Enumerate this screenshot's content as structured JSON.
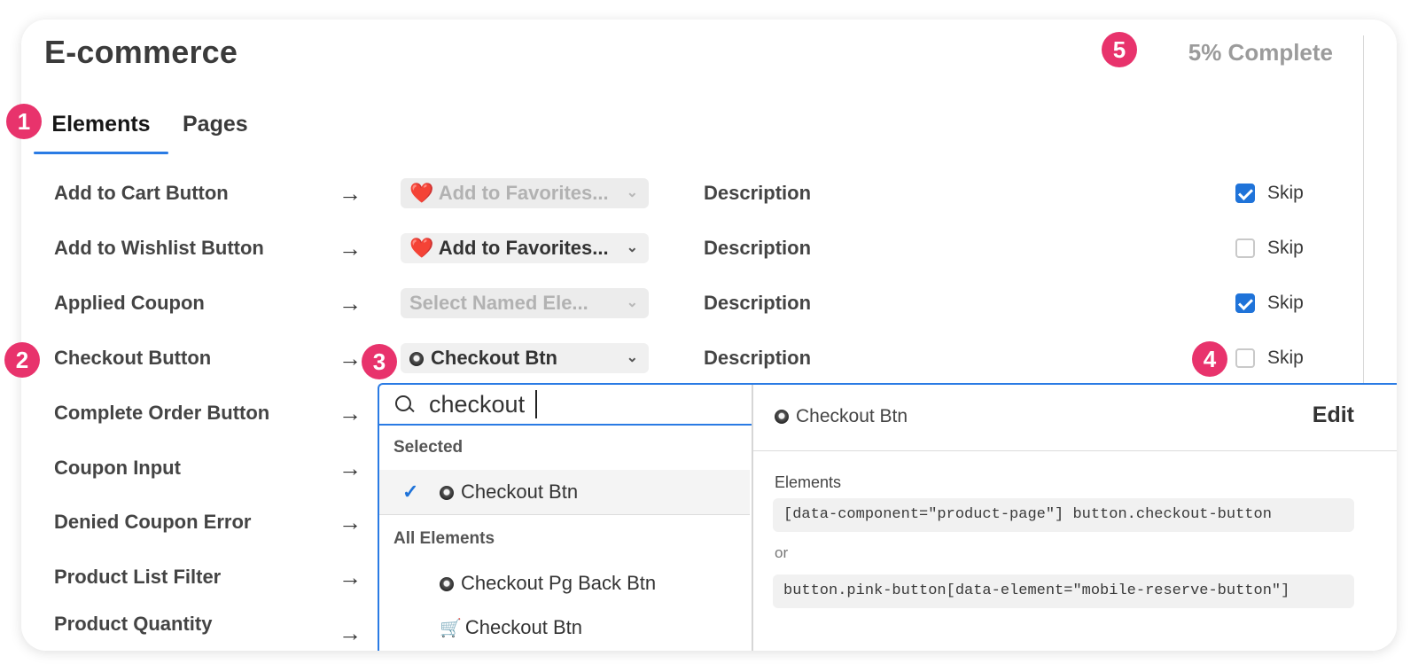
{
  "header": {
    "title": "E-commerce",
    "progress": "5% Complete"
  },
  "tabs": [
    {
      "label": "Elements"
    },
    {
      "label": "Pages"
    }
  ],
  "annotations": [
    "1",
    "2",
    "3",
    "4",
    "5"
  ],
  "rows": [
    {
      "label": "Add to Cart Button",
      "arrow": "→",
      "select": "❤️ Add to Favorites...",
      "select_state": "disabled",
      "description": "Description",
      "skip": "Skip",
      "skip_checked": true
    },
    {
      "label": "Add to Wishlist Button",
      "arrow": "→",
      "select": "❤️ Add to Favorites...",
      "select_state": "enabled",
      "description": "Description",
      "skip": "Skip",
      "skip_checked": false
    },
    {
      "label": "Applied Coupon",
      "arrow": "→",
      "select": "Select Named Ele...",
      "select_state": "disabled",
      "description": "Description",
      "skip": "Skip",
      "skip_checked": true
    },
    {
      "label": "Checkout Button",
      "arrow": "→",
      "select": "Checkout Btn",
      "select_state": "enabled",
      "description": "Description",
      "skip": "Skip",
      "skip_checked": false
    },
    {
      "label": "Complete Order Button",
      "arrow": "→"
    },
    {
      "label": "Coupon Input",
      "arrow": "→"
    },
    {
      "label": "Denied Coupon Error",
      "arrow": "→"
    },
    {
      "label": "Product List Filter",
      "arrow": "→"
    },
    {
      "label": "Product Quantity",
      "arrow": "→"
    }
  ],
  "dropdown": {
    "search_value": "checkout",
    "selected_heading": "Selected",
    "selected_item": "Checkout Btn",
    "all_heading": "All Elements",
    "items": [
      {
        "label": "Checkout Pg Back Btn",
        "icon": "radio-dot-icon"
      },
      {
        "label": "Checkout Btn",
        "icon": "cart-icon"
      }
    ],
    "preview": {
      "title": "Checkout Btn",
      "edit": "Edit",
      "elements_label": "Elements",
      "selector_1": "[data-component=\"product-page\"] button.checkout-button",
      "or": "or",
      "selector_2": "button.pink-button[data-element=\"mobile-reserve-button\"]"
    }
  },
  "colors": {
    "accent": "#2a7be4",
    "badge": "#e8336c",
    "checkbox": "#1f73d9"
  }
}
